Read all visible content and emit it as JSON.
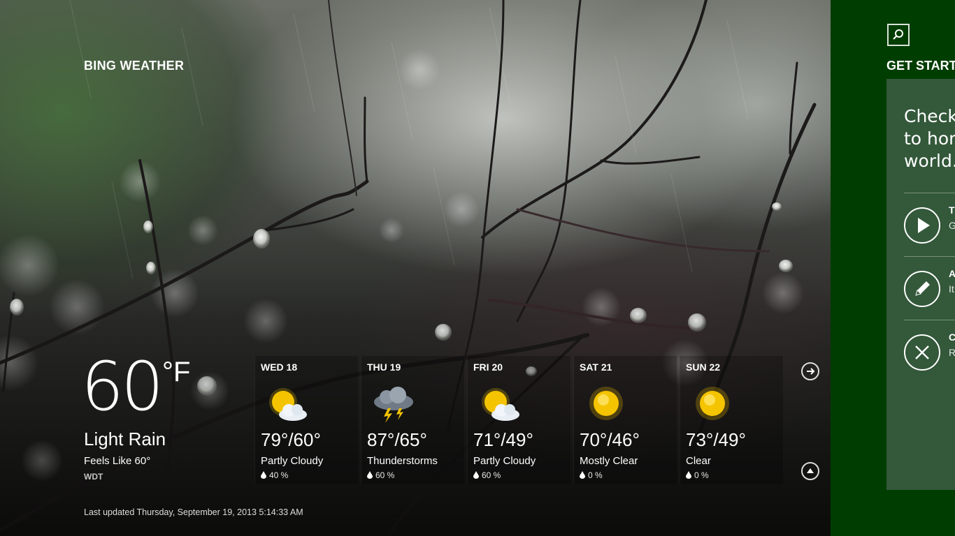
{
  "app": {
    "title": "BING WEATHER"
  },
  "current": {
    "temperature": "60",
    "unit": "°F",
    "condition": "Light Rain",
    "feels_like": "Feels Like 60°",
    "station": "WDT",
    "last_updated": "Last updated Thursday, September 19, 2013 5:14:33 AM"
  },
  "forecast": [
    {
      "day": "WED 18",
      "temps": "79°/60°",
      "condition": "Partly Cloudy",
      "precip": "40 %",
      "icon": "partly-cloudy-icon"
    },
    {
      "day": "THU 19",
      "temps": "87°/65°",
      "condition": "Thunderstorms",
      "precip": "60 %",
      "icon": "thunderstorm-icon"
    },
    {
      "day": "FRI 20",
      "temps": "71°/49°",
      "condition": "Partly Cloudy",
      "precip": "60 %",
      "icon": "partly-cloudy-icon"
    },
    {
      "day": "SAT 21",
      "temps": "70°/46°",
      "condition": "Mostly Clear",
      "precip": "0 %",
      "icon": "sun-icon"
    },
    {
      "day": "SUN 22",
      "temps": "73°/49°",
      "condition": "Clear",
      "precip": "0 %",
      "icon": "sun-icon"
    }
  ],
  "side": {
    "heading": "GET START",
    "headline_lines": [
      "Check",
      "to hom",
      "world."
    ],
    "items": [
      {
        "icon": "play-icon",
        "title": "T",
        "desc": "G g"
      },
      {
        "icon": "pencil-icon",
        "title": "A",
        "desc": "It p"
      },
      {
        "icon": "close-icon",
        "title": "C",
        "desc": "R S ti"
      }
    ]
  },
  "colors": {
    "side_panel": "#003d00",
    "card": "#33583a",
    "sun": "#f5c400"
  }
}
